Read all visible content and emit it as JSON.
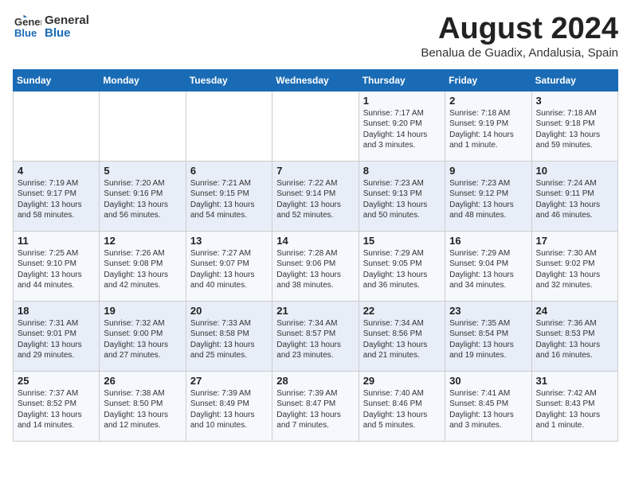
{
  "header": {
    "logo_general": "General",
    "logo_blue": "Blue",
    "month_title": "August 2024",
    "subtitle": "Benalua de Guadix, Andalusia, Spain"
  },
  "days_of_week": [
    "Sunday",
    "Monday",
    "Tuesday",
    "Wednesday",
    "Thursday",
    "Friday",
    "Saturday"
  ],
  "weeks": [
    [
      {
        "day": "",
        "info": ""
      },
      {
        "day": "",
        "info": ""
      },
      {
        "day": "",
        "info": ""
      },
      {
        "day": "",
        "info": ""
      },
      {
        "day": "1",
        "info": "Sunrise: 7:17 AM\nSunset: 9:20 PM\nDaylight: 14 hours\nand 3 minutes."
      },
      {
        "day": "2",
        "info": "Sunrise: 7:18 AM\nSunset: 9:19 PM\nDaylight: 14 hours\nand 1 minute."
      },
      {
        "day": "3",
        "info": "Sunrise: 7:18 AM\nSunset: 9:18 PM\nDaylight: 13 hours\nand 59 minutes."
      }
    ],
    [
      {
        "day": "4",
        "info": "Sunrise: 7:19 AM\nSunset: 9:17 PM\nDaylight: 13 hours\nand 58 minutes."
      },
      {
        "day": "5",
        "info": "Sunrise: 7:20 AM\nSunset: 9:16 PM\nDaylight: 13 hours\nand 56 minutes."
      },
      {
        "day": "6",
        "info": "Sunrise: 7:21 AM\nSunset: 9:15 PM\nDaylight: 13 hours\nand 54 minutes."
      },
      {
        "day": "7",
        "info": "Sunrise: 7:22 AM\nSunset: 9:14 PM\nDaylight: 13 hours\nand 52 minutes."
      },
      {
        "day": "8",
        "info": "Sunrise: 7:23 AM\nSunset: 9:13 PM\nDaylight: 13 hours\nand 50 minutes."
      },
      {
        "day": "9",
        "info": "Sunrise: 7:23 AM\nSunset: 9:12 PM\nDaylight: 13 hours\nand 48 minutes."
      },
      {
        "day": "10",
        "info": "Sunrise: 7:24 AM\nSunset: 9:11 PM\nDaylight: 13 hours\nand 46 minutes."
      }
    ],
    [
      {
        "day": "11",
        "info": "Sunrise: 7:25 AM\nSunset: 9:10 PM\nDaylight: 13 hours\nand 44 minutes."
      },
      {
        "day": "12",
        "info": "Sunrise: 7:26 AM\nSunset: 9:08 PM\nDaylight: 13 hours\nand 42 minutes."
      },
      {
        "day": "13",
        "info": "Sunrise: 7:27 AM\nSunset: 9:07 PM\nDaylight: 13 hours\nand 40 minutes."
      },
      {
        "day": "14",
        "info": "Sunrise: 7:28 AM\nSunset: 9:06 PM\nDaylight: 13 hours\nand 38 minutes."
      },
      {
        "day": "15",
        "info": "Sunrise: 7:29 AM\nSunset: 9:05 PM\nDaylight: 13 hours\nand 36 minutes."
      },
      {
        "day": "16",
        "info": "Sunrise: 7:29 AM\nSunset: 9:04 PM\nDaylight: 13 hours\nand 34 minutes."
      },
      {
        "day": "17",
        "info": "Sunrise: 7:30 AM\nSunset: 9:02 PM\nDaylight: 13 hours\nand 32 minutes."
      }
    ],
    [
      {
        "day": "18",
        "info": "Sunrise: 7:31 AM\nSunset: 9:01 PM\nDaylight: 13 hours\nand 29 minutes."
      },
      {
        "day": "19",
        "info": "Sunrise: 7:32 AM\nSunset: 9:00 PM\nDaylight: 13 hours\nand 27 minutes."
      },
      {
        "day": "20",
        "info": "Sunrise: 7:33 AM\nSunset: 8:58 PM\nDaylight: 13 hours\nand 25 minutes."
      },
      {
        "day": "21",
        "info": "Sunrise: 7:34 AM\nSunset: 8:57 PM\nDaylight: 13 hours\nand 23 minutes."
      },
      {
        "day": "22",
        "info": "Sunrise: 7:34 AM\nSunset: 8:56 PM\nDaylight: 13 hours\nand 21 minutes."
      },
      {
        "day": "23",
        "info": "Sunrise: 7:35 AM\nSunset: 8:54 PM\nDaylight: 13 hours\nand 19 minutes."
      },
      {
        "day": "24",
        "info": "Sunrise: 7:36 AM\nSunset: 8:53 PM\nDaylight: 13 hours\nand 16 minutes."
      }
    ],
    [
      {
        "day": "25",
        "info": "Sunrise: 7:37 AM\nSunset: 8:52 PM\nDaylight: 13 hours\nand 14 minutes."
      },
      {
        "day": "26",
        "info": "Sunrise: 7:38 AM\nSunset: 8:50 PM\nDaylight: 13 hours\nand 12 minutes."
      },
      {
        "day": "27",
        "info": "Sunrise: 7:39 AM\nSunset: 8:49 PM\nDaylight: 13 hours\nand 10 minutes."
      },
      {
        "day": "28",
        "info": "Sunrise: 7:39 AM\nSunset: 8:47 PM\nDaylight: 13 hours\nand 7 minutes."
      },
      {
        "day": "29",
        "info": "Sunrise: 7:40 AM\nSunset: 8:46 PM\nDaylight: 13 hours\nand 5 minutes."
      },
      {
        "day": "30",
        "info": "Sunrise: 7:41 AM\nSunset: 8:45 PM\nDaylight: 13 hours\nand 3 minutes."
      },
      {
        "day": "31",
        "info": "Sunrise: 7:42 AM\nSunset: 8:43 PM\nDaylight: 13 hours\nand 1 minute."
      }
    ]
  ]
}
